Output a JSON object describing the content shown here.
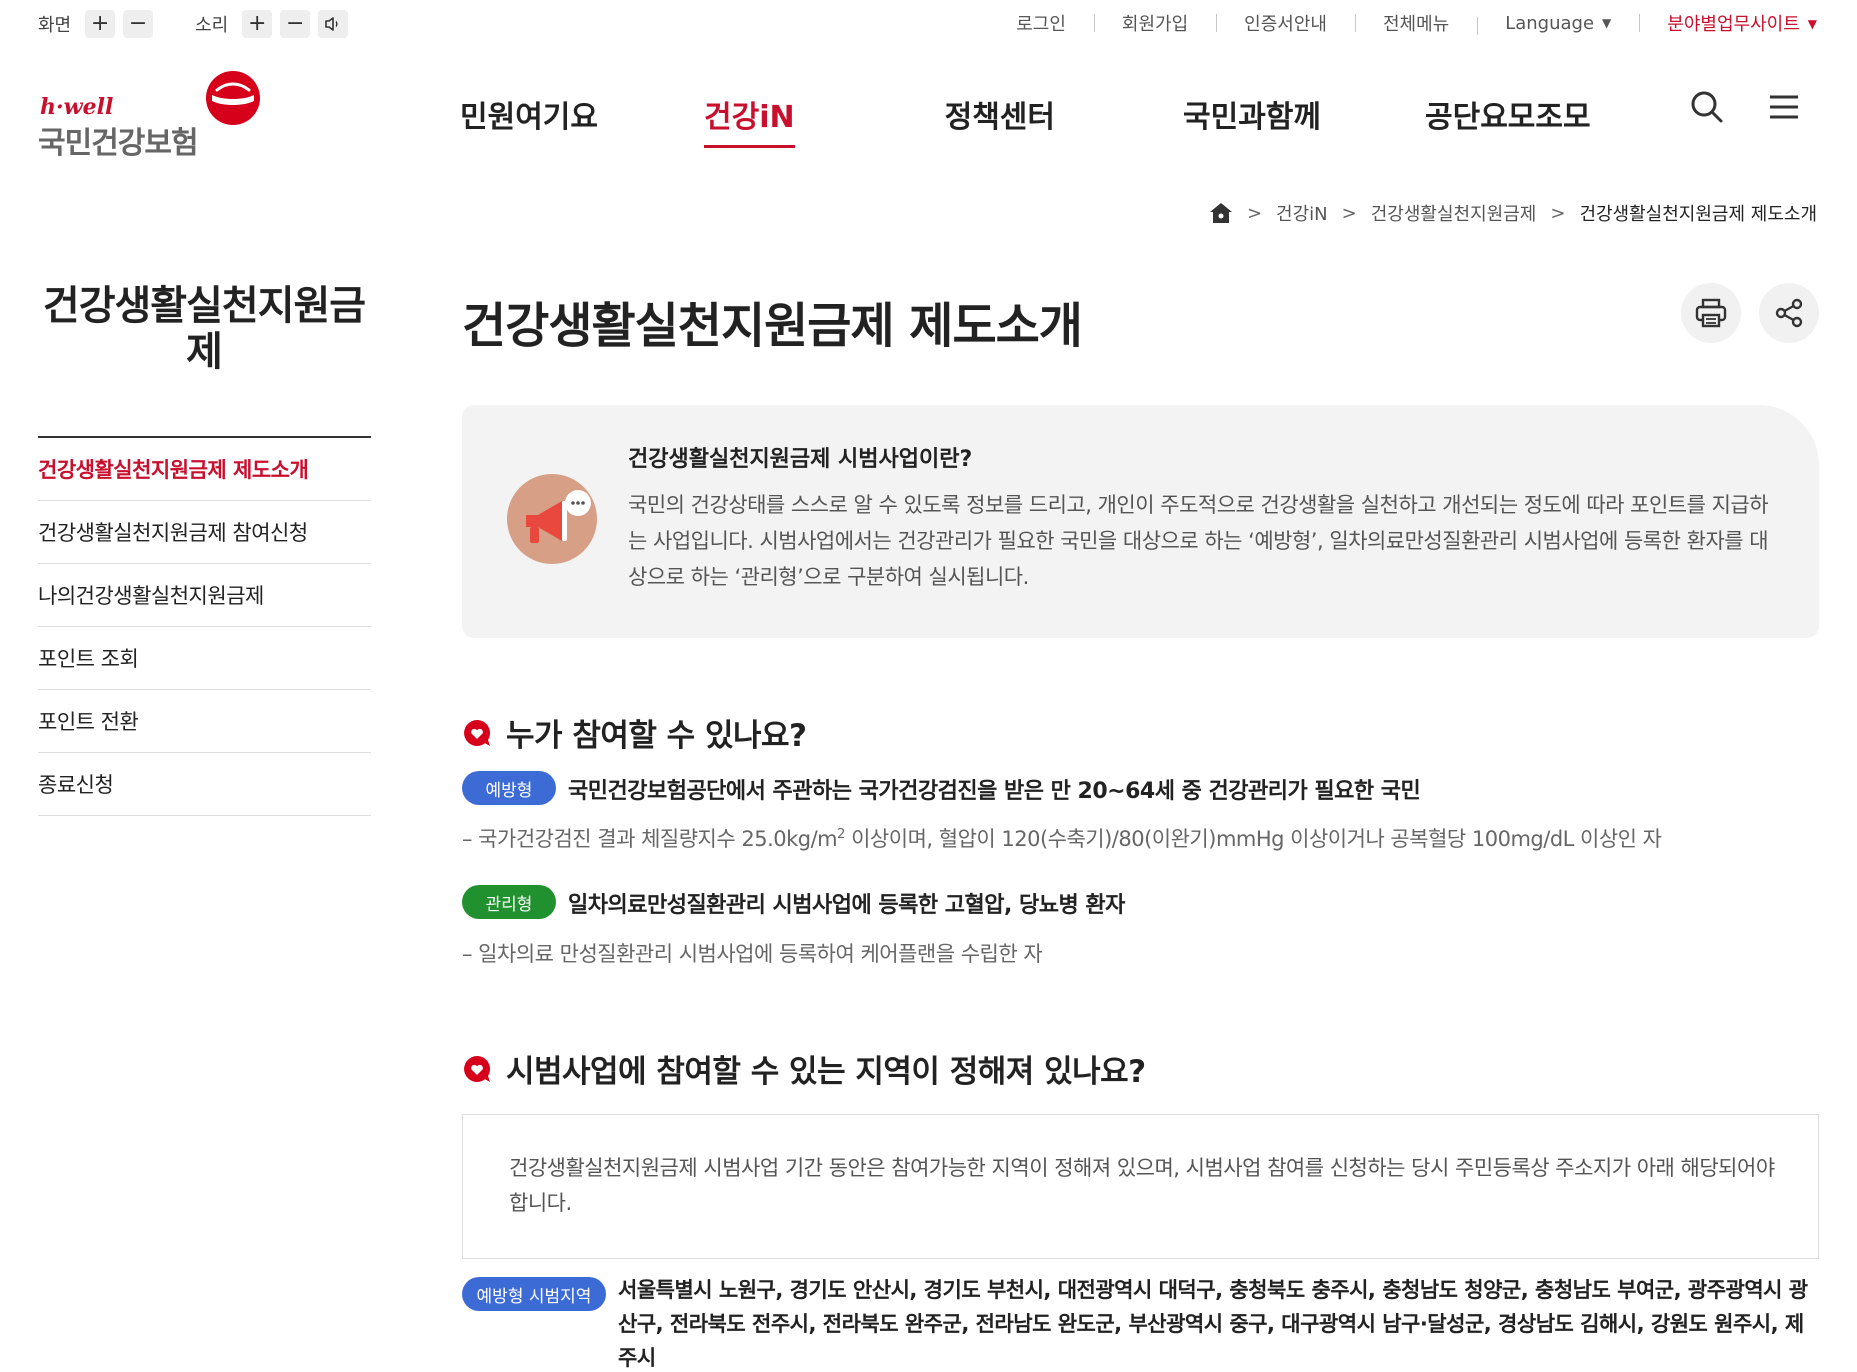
{
  "utility": {
    "screen_label": "화면",
    "sound_label": "소리",
    "plus": "+",
    "minus": "−",
    "links": [
      "로그인",
      "회원가입",
      "인증서안내",
      "전체메뉴"
    ],
    "language": "Language",
    "field_sites": "분야별업무사이트"
  },
  "logo": {
    "sub": "h·well",
    "main": "국민건강보험"
  },
  "gnb": {
    "items": [
      "민원여기요",
      "건강iN",
      "정책센터",
      "국민과함께",
      "공단요모조모"
    ],
    "active_index": 1
  },
  "breadcrumb": {
    "items": [
      "건강iN",
      "건강생활실천지원금제",
      "건강생활실천지원금제 제도소개"
    ]
  },
  "sidebar": {
    "title": "건강생활실천지원금제",
    "items": [
      "건강생활실천지원금제 제도소개",
      "건강생활실천지원금제 참여신청",
      "나의건강생활실천지원금제",
      "포인트 조회",
      "포인트 전환",
      "종료신청"
    ]
  },
  "main": {
    "title": "건강생활실천지원금제 제도소개",
    "intro": {
      "title": "건강생활실천지원금제 시범사업이란?",
      "text": "국민의 건강상태를 스스로 알 수 있도록 정보를 드리고, 개인이 주도적으로 건강생활을 실천하고 개선되는 정도에 따라 포인트를 지급하는 사업입니다. 시범사업에서는 건강관리가 필요한 국민을 대상으로 하는 ‘예방형’, 일차의료만성질환관리 시범사업에 등록한 환자를 대상으로 하는 ‘관리형’으로 구분하여 실시됩니다."
    },
    "section1": {
      "title": "누가 참여할 수 있나요?",
      "prevent_badge": "예방형",
      "prevent_head": "국민건강보험공단에서 주관하는 국가건강검진을 받은 만 20~64세 중 건강관리가 필요한 국민",
      "prevent_desc_a": "– 국가건강검진 결과 체질량지수 25.0kg/m",
      "prevent_desc_sup": "2",
      "prevent_desc_b": " 이상이며, 혈압이 120(수축기)/80(이완기)mmHg 이상이거나 공복혈당 100mg/dL 이상인 자",
      "manage_badge": "관리형",
      "manage_head": "일차의료만성질환관리 시범사업에 등록한 고혈압, 당뇨병 환자",
      "manage_desc": "– 일차의료 만성질환관리 시범사업에 등록하여 케어플랜을 수립한 자"
    },
    "section2": {
      "title": "시범사업에 참여할 수 있는 지역이 정해져 있나요?",
      "box_text": "건강생활실천지원금제 시범사업 기간 동안은 참여가능한 지역이 정해져 있으며, 시범사업 참여를 신청하는 당시 주민등록상 주소지가 아래 해당되어야 합니다.",
      "region_badge": "예방형 시범지역",
      "regions": "서울특별시 노원구, 경기도 안산시, 경기도 부천시, 대전광역시 대덕구, 충청북도 충주시, 충청남도 청양군, 충청남도 부여군, 광주광역시 광산구, 전라북도 전주시, 전라북도 완주군, 전라남도 완도군, 부산광역시 중구, 대구광역시 남구·달성군, 경상남도 김해시, 강원도 원주시, 제주시"
    }
  },
  "colors": {
    "brand_red": "#c8102e",
    "badge_blue": "#3d6bd6",
    "badge_green": "#21912f"
  },
  "icons": [
    "search-icon",
    "menu-icon",
    "home-icon",
    "print-icon",
    "share-icon",
    "megaphone-icon",
    "speech-heart-icon",
    "speaker-icon"
  ]
}
